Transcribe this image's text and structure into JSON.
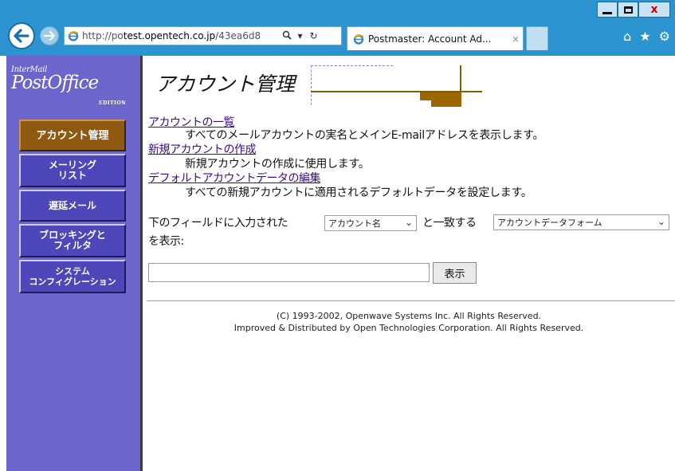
{
  "browser": {
    "url_prefix": "http://po",
    "url_domain": "test.opentech.co.jp",
    "url_path": "/43ea6d8",
    "tab_title": "Postmaster: Account Ad...",
    "tab_close": "×"
  },
  "window": {
    "close_label": "x"
  },
  "sidebar": {
    "logo_top": "InterMail",
    "logo_main": "PostOffice",
    "logo_sub": "EDITION",
    "items": [
      {
        "line1": "アカウント管理",
        "line2": ""
      },
      {
        "line1": "メーリング",
        "line2": "リスト"
      },
      {
        "line1": "遅延メール",
        "line2": ""
      },
      {
        "line1": "ブロッキングと",
        "line2": "フィルタ"
      },
      {
        "line1": "システム",
        "line2": "コンフィグレーション"
      }
    ],
    "active_index": 0
  },
  "main": {
    "title": "アカウント管理",
    "links": [
      {
        "label": "アカウントの一覧",
        "description": "すべてのメールアカウントの実名とメインE-mailアドレスを表示します。"
      },
      {
        "label": "新規アカウントの作成",
        "description": "新規アカウントの作成に使用します。"
      },
      {
        "label": "デフォルトアカウントデータの編集",
        "description": "すべての新規アカウントに適用されるデフォルトデータを設定します。"
      }
    ],
    "search": {
      "label_before": "下のフィールドに入力された",
      "field_select": "アカウント名",
      "label_middle": "と一致する",
      "form_select": "アカウントデータフォーム",
      "label_after": "を表示:",
      "input_value": "",
      "button_label": "表示"
    }
  },
  "footer": {
    "line1": "(C) 1993-2002, Openwave Systems Inc. All Rights Reserved.",
    "line2": "Improved & Distributed by Open Technologies Corporation. All Rights Reserved."
  }
}
